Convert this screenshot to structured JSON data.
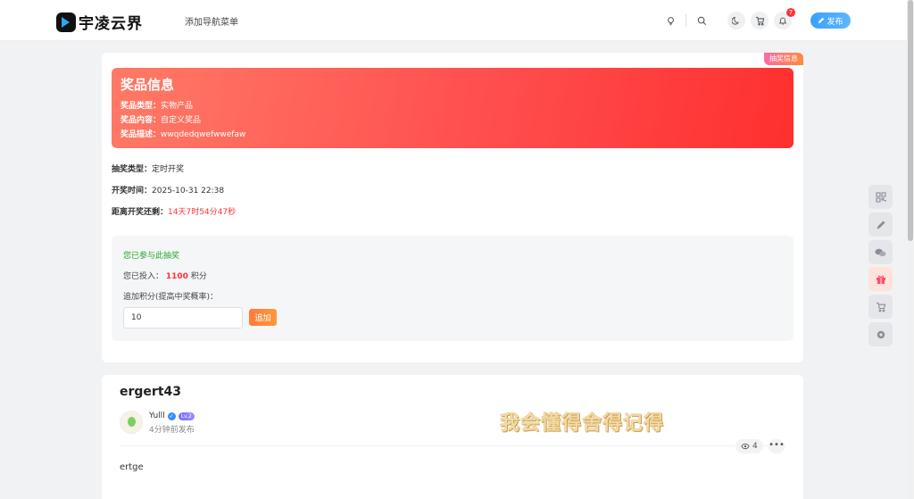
{
  "header": {
    "brand": "宇凌云界",
    "nav_link": "添加导航菜单",
    "notification_count": "7",
    "publish_label": "发布",
    "icons": [
      "lightbulb-icon",
      "search-icon",
      "moon-icon",
      "cart-icon",
      "bell-icon",
      "pencil-icon"
    ]
  },
  "lottery": {
    "ribbon": "抽奖信息",
    "prize_title": "奖品信息",
    "prize_type_label": "奖品类型：",
    "prize_type_value": "实物产品",
    "prize_content_label": "奖品内容：",
    "prize_content_value": "自定义奖品",
    "prize_desc_label": "奖品描述：",
    "prize_desc_value": "wwqdedqwefwwefaw",
    "draw_type_label": "抽奖类型：",
    "draw_type_value": "定时开奖",
    "draw_time_label": "开奖时间：",
    "draw_time_value": "2025-10-31 22:38",
    "countdown_label": "距离开奖还剩：",
    "countdown_value": "14天7时54分47秒",
    "joined_text": "您已参与此抽奖",
    "invested_prefix": "您已投入：",
    "invested_amount": "1100",
    "invested_unit": "积分",
    "add_points_label": "追加积分(提高中奖概率)：",
    "add_points_value": "10",
    "add_button": "追加"
  },
  "post": {
    "title": "ergert43",
    "author": "Yulll",
    "level": "Lv.2",
    "time": "4分钟前发布",
    "watermark": "我会懂得舍得记得",
    "views": "4",
    "body": "ertge"
  },
  "side_tools": [
    "qrcode-icon",
    "edit-icon",
    "wechat-icon",
    "gift-icon",
    "cart-icon",
    "gear-icon"
  ],
  "colors": {
    "prize_gradient_start": "#ff7a66",
    "prize_gradient_end": "#ff2f2f",
    "accent_blue": "#3aa0ff",
    "accent_red": "#ff3333",
    "joined_green": "#2aa52a"
  }
}
